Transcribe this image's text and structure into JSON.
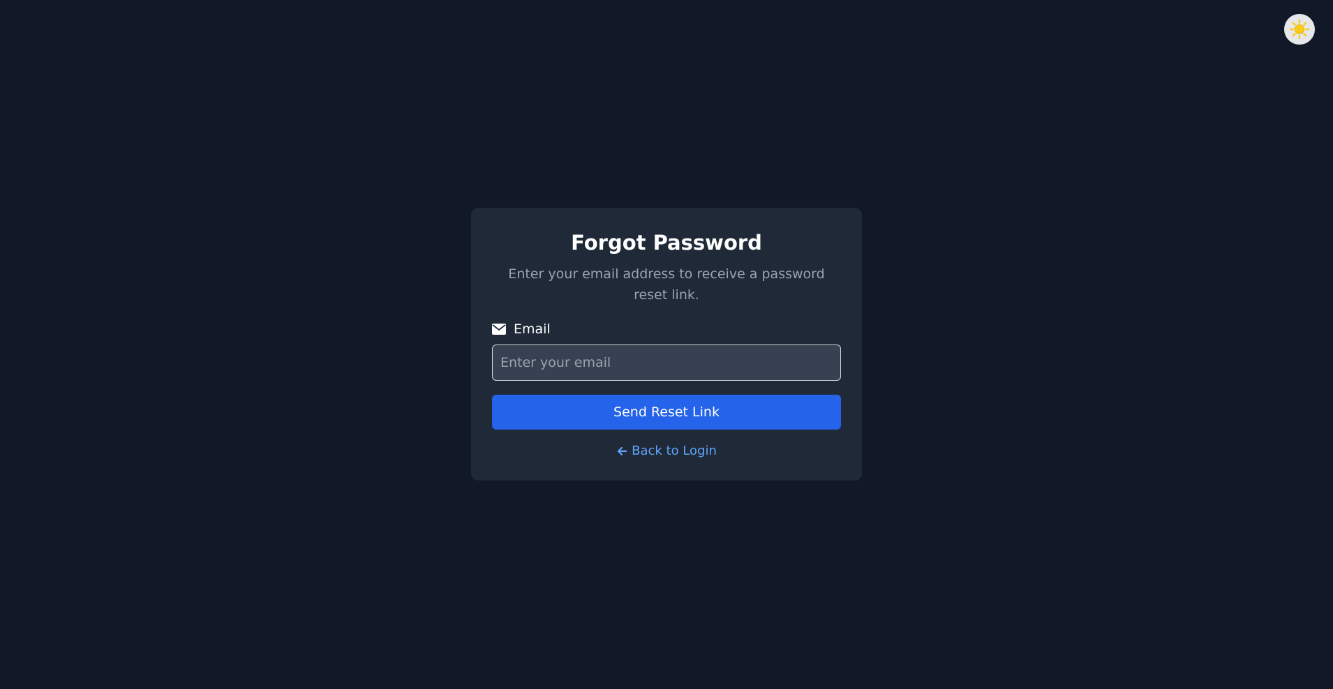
{
  "theme_toggle": {
    "icon": "sun-icon",
    "color": "#facc15"
  },
  "card": {
    "title": "Forgot Password",
    "subtitle": "Enter your email address to receive a password reset link.",
    "email": {
      "icon": "envelope-icon",
      "label": "Email",
      "placeholder": "Enter your email",
      "value": ""
    },
    "submit_label": "Send Reset Link",
    "back_link": {
      "icon": "arrow-left-icon",
      "label": "Back to Login"
    }
  },
  "colors": {
    "background": "#111827",
    "card": "#1f2937",
    "primary": "#2563eb",
    "link": "#60a5fa"
  }
}
